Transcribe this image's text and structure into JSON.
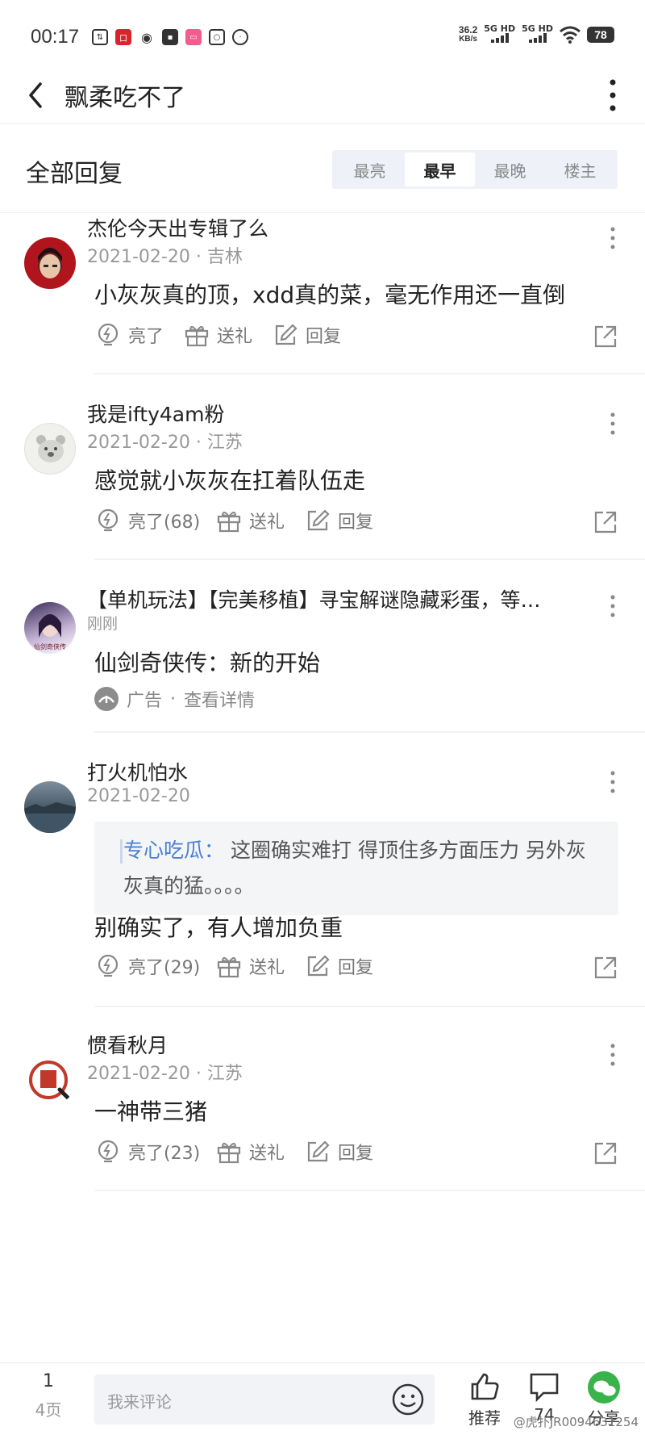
{
  "status_bar": {
    "time": "00:17",
    "net_speed_value": "36.2",
    "net_speed_unit": "KB/s",
    "sim1_label": "5G HD",
    "sim2_label": "5G HD",
    "battery": "78",
    "app_icons": [
      "sync-icon",
      "app-red-icon",
      "weibo-icon",
      "app-dark-icon",
      "bilibili-icon",
      "search-app-icon",
      "wechat-icon"
    ]
  },
  "nav": {
    "title": "飘柔吃不了"
  },
  "sort": {
    "title": "全部回复",
    "tabs": [
      "最亮",
      "最早",
      "最晚",
      "楼主"
    ],
    "active_tab": "最早"
  },
  "posts": [
    {
      "username": "杰伦今天出专辑了么",
      "date": "2021-02-20",
      "location": "吉林",
      "meta": "2021-02-20 · 吉林",
      "body": "小灰灰真的顶，xdd真的菜，毫无作用还一直倒",
      "light_label": "亮了",
      "gift_label": "送礼",
      "reply_label": "回复"
    },
    {
      "username": "我是ifty4am粉",
      "date": "2021-02-20",
      "location": "江苏",
      "meta": "2021-02-20 · 江苏",
      "body": "感觉就小灰灰在扛着队伍走",
      "light_label": "亮了(68)",
      "gift_label": "送礼",
      "reply_label": "回复"
    },
    {
      "username": "打火机怕水",
      "date": "2021-02-20",
      "meta": "2021-02-20",
      "quote_author": "专心吃瓜：",
      "quote_text": "这圈确实难打 得顶住多方面压力 另外灰灰真的猛。。。。",
      "body": "别确实了，有人增加负重",
      "light_label": "亮了(29)",
      "gift_label": "送礼",
      "reply_label": "回复"
    },
    {
      "username": "惯看秋月",
      "date": "2021-02-20",
      "location": "江苏",
      "meta": "2021-02-20 · 江苏",
      "body": "一神带三猪",
      "light_label": "亮了(23)",
      "gift_label": "送礼",
      "reply_label": "回复"
    }
  ],
  "ad": {
    "title": "【单机玩法】【完美移植】寻宝解谜隐藏彩蛋，等…",
    "time": "刚刚",
    "body": "仙剑奇侠传：新的开始",
    "ad_label": "广告",
    "separator": "·",
    "detail_label": "查看详情",
    "avatar_text": "仙剑奇侠传"
  },
  "bottom_bar": {
    "page_current": "1",
    "page_total": "4页",
    "comment_placeholder": "我来评论",
    "recommend_label": "推荐",
    "comment_count": "74",
    "share_label": "分享",
    "watermark": "@虎扑JR0094631254"
  },
  "colors": {
    "accent_blue": "#4a7fd6",
    "sort_bg": "#eef2f8",
    "text_primary": "#222222",
    "text_secondary": "#999999",
    "wechat_green": "#3ab34a"
  }
}
